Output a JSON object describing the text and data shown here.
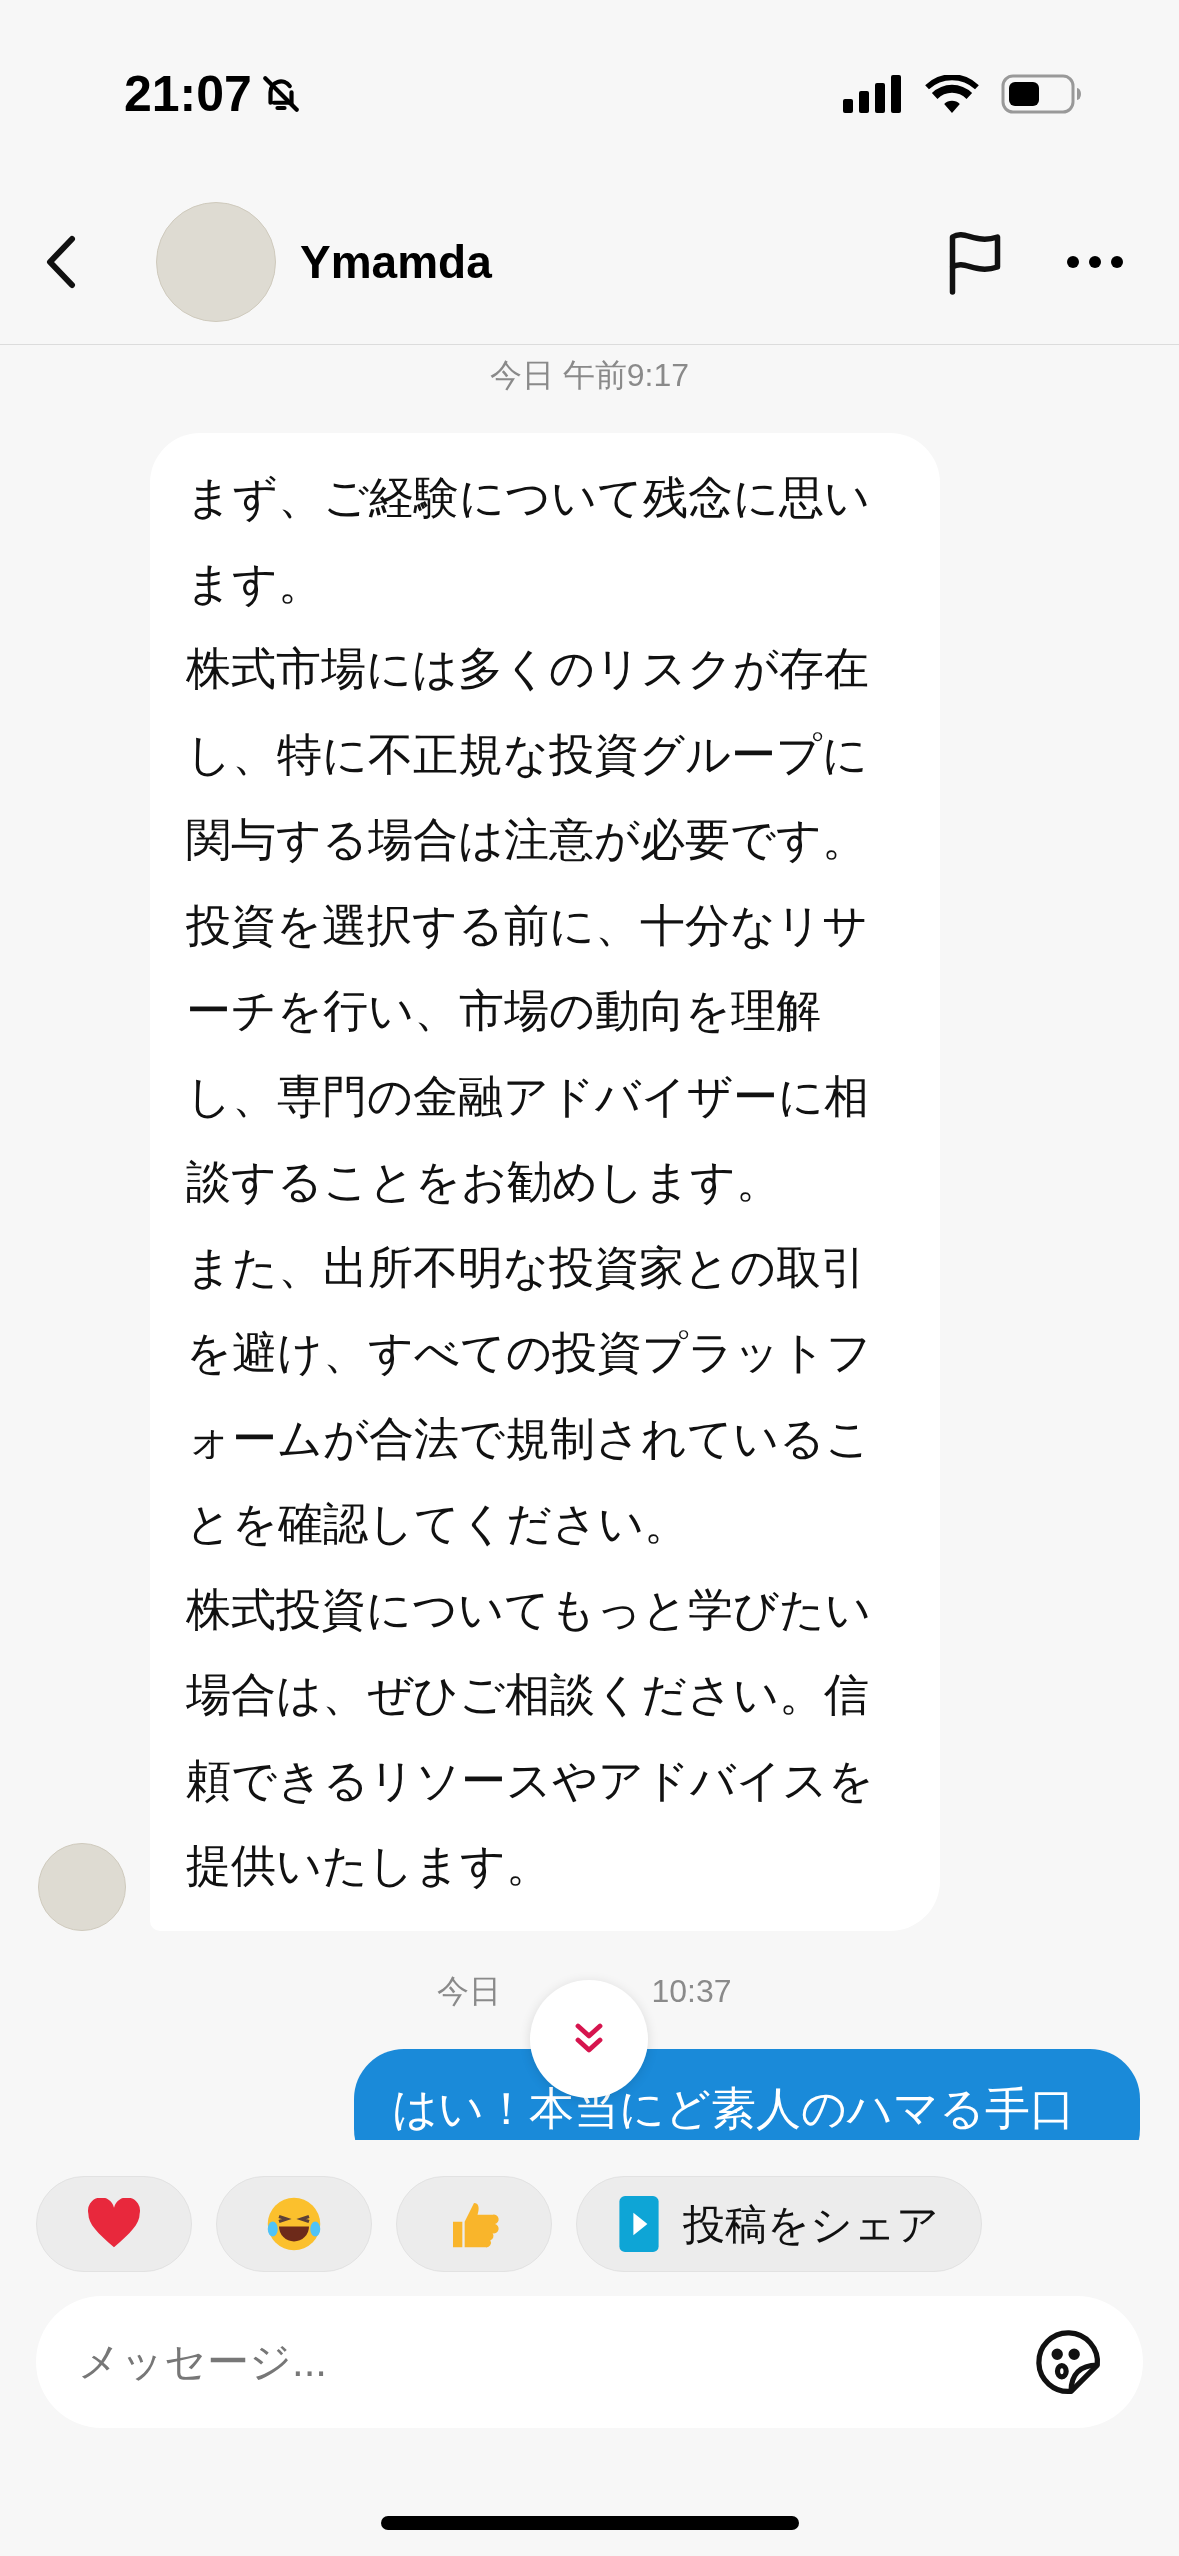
{
  "status_bar": {
    "time": "21:07",
    "silent": true
  },
  "header": {
    "name": "Ymamda"
  },
  "messages": [
    {
      "kind": "timestamp",
      "text": "今日 午前9:17"
    },
    {
      "kind": "incoming",
      "paragraphs": [
        "まず、ご経験について残念に思います。",
        "株式市場には多くのリスクが存在し、特に不正規な投資グループに関与する場合は注意が必要です。",
        "投資を選択する前に、十分なリサーチを行い、市場の動向を理解し、専門の金融アドバイザーに相談することをお勧めします。",
        "また、出所不明な投資家との取引を避け、すべての投資プラットフォームが合法で規制されていることを確認してください。",
        "株式投資についてもっと学びたい場合は、ぜひご相談ください。信頼できるリソースやアドバイスを提供いたします。"
      ]
    },
    {
      "kind": "timestamp",
      "parts": [
        "今日",
        "10:37"
      ]
    },
    {
      "kind": "outgoing",
      "paragraphs": [
        "はい！本当にど素人のハマる手口"
      ]
    }
  ],
  "reactions": [
    {
      "kind": "heart"
    },
    {
      "kind": "laugh"
    },
    {
      "kind": "thumbs"
    },
    {
      "kind": "share",
      "label": "投稿をシェア"
    }
  ],
  "composer": {
    "placeholder": "メッセージ..."
  }
}
